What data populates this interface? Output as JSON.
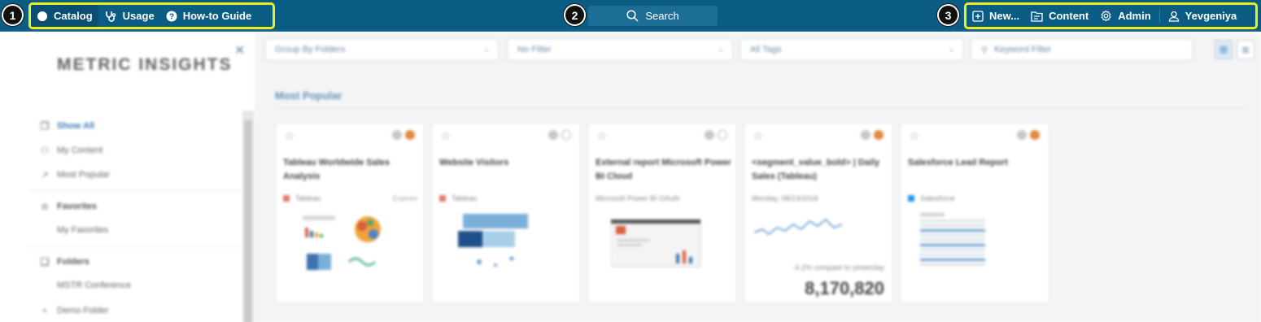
{
  "topnav": {
    "left": [
      {
        "label": "Catalog",
        "icon": "catalog-icon"
      },
      {
        "label": "Usage",
        "icon": "stethoscope-icon"
      },
      {
        "label": "How-to Guide",
        "icon": "help-icon"
      }
    ],
    "search_label": "Search",
    "right": [
      {
        "label": "New...",
        "icon": "plus-square-icon"
      },
      {
        "label": "Content",
        "icon": "content-icon"
      },
      {
        "label": "Admin",
        "icon": "gear-icon"
      },
      {
        "label": "Yevgeniya",
        "icon": "user-icon"
      }
    ]
  },
  "callouts": [
    "1",
    "2",
    "3"
  ],
  "sidebar": {
    "logo": "METRIC INSIGHTS",
    "items": [
      {
        "label": "Show All",
        "icon": "layers-icon"
      },
      {
        "label": "My Content",
        "icon": "person-icon"
      },
      {
        "label": "Most Popular",
        "icon": "trend-icon"
      },
      {
        "label": "Favorites",
        "icon": "star-icon"
      },
      {
        "label": "My Favorites"
      },
      {
        "label": "Folders",
        "icon": "folders-icon"
      },
      {
        "label": "MSTR Conference"
      },
      {
        "label": "Demo Folder",
        "icon": "plus-icon"
      }
    ]
  },
  "filters": {
    "group_by": "Group By Folders",
    "filter": "No Filter",
    "tags": "All Tags",
    "keyword_placeholder": "Keyword Filter"
  },
  "section_title": "Most Popular",
  "cards": [
    {
      "title": "Tableau Worldwide Sales Analysis",
      "source": "Tableau",
      "status": "Expires"
    },
    {
      "title": "Website Visitors",
      "source": "Tableau"
    },
    {
      "title": "External report Microsoft Power BI Cloud",
      "source": "Microsoft Power BI OAuth"
    },
    {
      "title": "<segment_value_bold> | Daily Sales (Tableau)",
      "date": "Monday, 08/13/2018",
      "compare": "-4.2% compare to yesterday",
      "value": "8,170,820"
    },
    {
      "title": "Salesforce Lead Report",
      "source": "Salesforce"
    }
  ],
  "colors": {
    "topbar": "#0b5c85",
    "highlight": "#e9f01e",
    "accent": "#3b7ab2",
    "orange": "#e08a3d"
  }
}
